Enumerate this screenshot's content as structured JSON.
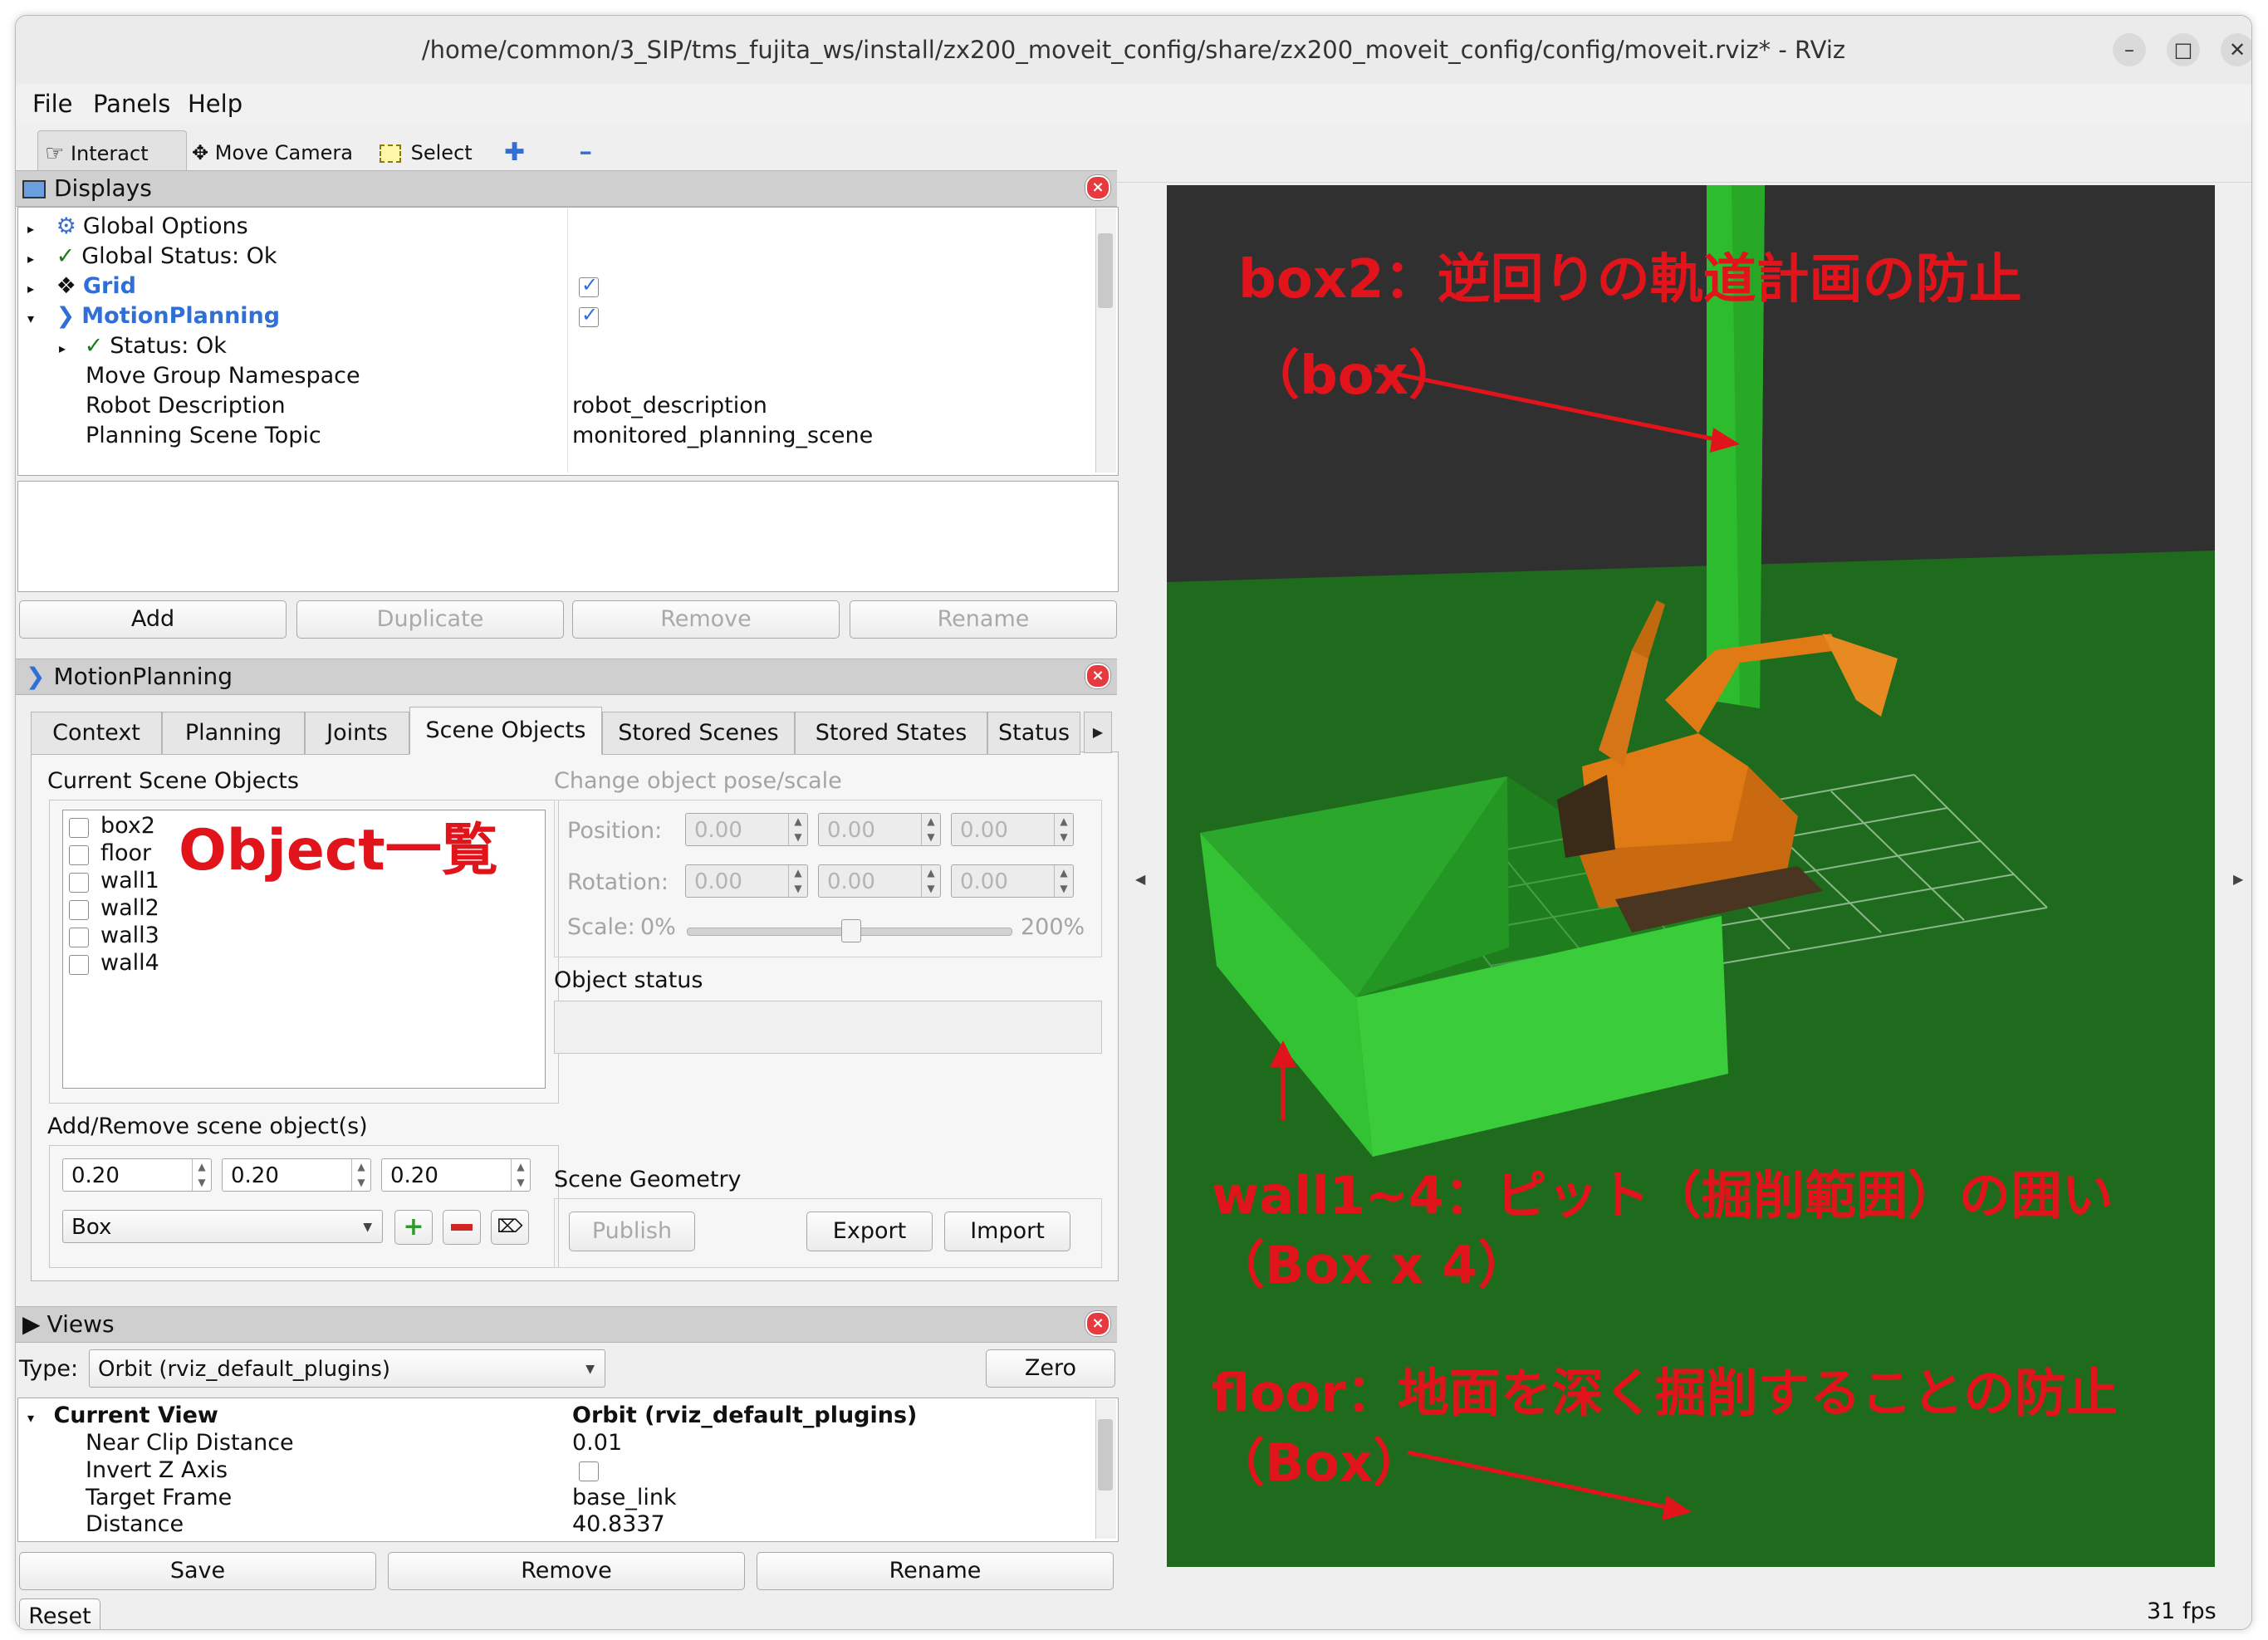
{
  "window": {
    "title": "/home/common/3_SIP/tms_fujita_ws/install/zx200_moveit_config/share/zx200_moveit_config/config/moveit.rviz* - RViz",
    "minimize": "–",
    "maximize": "□",
    "close": "✕"
  },
  "menu": {
    "file": "File",
    "panels": "Panels",
    "help": "Help"
  },
  "toolbar": {
    "interact": "Interact",
    "move_camera": "Move Camera",
    "select": "Select",
    "plus": "✚",
    "minus": "━"
  },
  "displays": {
    "title": "Displays",
    "rows": [
      {
        "label": "Global Options",
        "value": ""
      },
      {
        "label": "Global Status: Ok",
        "value": ""
      },
      {
        "label": "Grid",
        "value": ""
      },
      {
        "label": "MotionPlanning",
        "value": ""
      },
      {
        "label": "Status: Ok",
        "value": ""
      },
      {
        "label": "Move Group Namespace",
        "value": ""
      },
      {
        "label": "Robot Description",
        "value": "robot_description"
      },
      {
        "label": "Planning Scene Topic",
        "value": "monitored_planning_scene"
      }
    ],
    "buttons": {
      "add": "Add",
      "duplicate": "Duplicate",
      "remove": "Remove",
      "rename": "Rename"
    }
  },
  "motion_planning": {
    "title": "MotionPlanning",
    "tabs": [
      "Context",
      "Planning",
      "Joints",
      "Scene Objects",
      "Stored Scenes",
      "Stored States",
      "Status"
    ],
    "current_scene_objects": "Current Scene Objects",
    "objects": [
      "box2",
      "floor",
      "wall1",
      "wall2",
      "wall3",
      "wall4"
    ],
    "change_pose": "Change object pose/scale",
    "position_label": "Position:",
    "rotation_label": "Rotation:",
    "scale_label": "Scale:",
    "scale_min": "0%",
    "scale_max": "200%",
    "pose_value": "0.00",
    "object_status": "Object status",
    "add_remove": "Add/Remove scene object(s)",
    "size_x": "0.20",
    "size_y": "0.20",
    "size_z": "0.20",
    "shape": "Box",
    "scene_geometry": "Scene Geometry",
    "publish": "Publish",
    "export": "Export",
    "import": "Import"
  },
  "views": {
    "title": "Views",
    "type_label": "Type:",
    "type_value": "Orbit (rviz_default_plugins)",
    "zero": "Zero",
    "rows": [
      {
        "label": "Current View",
        "value": "Orbit (rviz_default_plugins)"
      },
      {
        "label": "Near Clip Distance",
        "value": "0.01"
      },
      {
        "label": "Invert Z Axis",
        "value": ""
      },
      {
        "label": "Target Frame",
        "value": "base_link"
      },
      {
        "label": "Distance",
        "value": "40.8337"
      }
    ],
    "save": "Save",
    "remove": "Remove",
    "rename": "Rename"
  },
  "status": {
    "reset": "Reset",
    "fps": "31 fps"
  },
  "annotations": {
    "object_list": "Object一覧",
    "box2_line1": "box2：逆回りの軌道計画の防止",
    "box2_line2": "（box）",
    "wall_line1": "wall1~4：ピット（掘削範囲）の囲い",
    "wall_line2": "（Box x 4）",
    "floor_line1": "floor：地面を深く掘削することの防止",
    "floor_line2": "（Box）"
  },
  "colors": {
    "annotation": "#e1141b",
    "floor": "#1f6b1d",
    "sky": "#303030",
    "object": "#2fbf2f",
    "robot": "#e07a14"
  }
}
